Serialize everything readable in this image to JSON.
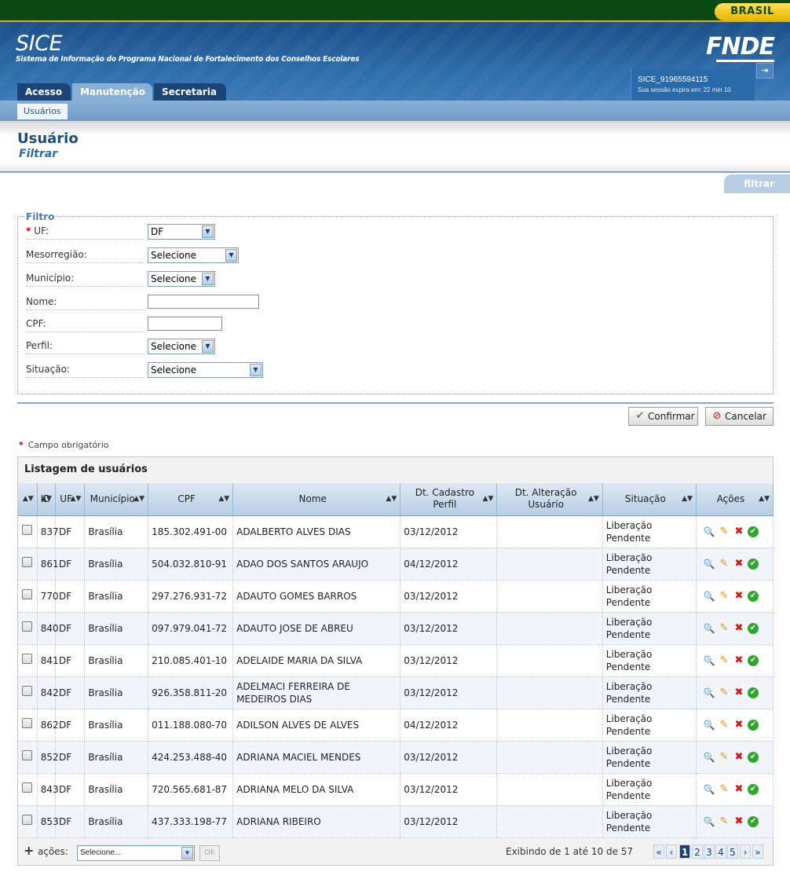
{
  "gov_badge": "BRASIL",
  "header": {
    "app_name": "SICE",
    "app_subtitle": "Sistema de Informação do Programa Nacional de Fortalecimento dos Conselhos Escolares",
    "logo": "FNDE",
    "session_user": "SICE_91965594115",
    "session_expire": "Sua sessão expira em: 22 min 10"
  },
  "tabs": [
    {
      "label": "Acesso"
    },
    {
      "label": "Manutenção",
      "active": true
    },
    {
      "label": "Secretaria"
    }
  ],
  "subnav": {
    "item": "Usuários"
  },
  "page": {
    "title": "Usuário",
    "subtitle": "Filtrar",
    "filter_tab": "filtrar"
  },
  "filter": {
    "legend": "Filtro",
    "required_mark": "*",
    "fields": {
      "uf": {
        "label": "UF:",
        "value": "DF"
      },
      "mesorregiao": {
        "label": "Mesorregião:",
        "value": "Selecione"
      },
      "municipio": {
        "label": "Município:",
        "value": "Selecione"
      },
      "nome": {
        "label": "Nome:",
        "value": ""
      },
      "cpf": {
        "label": "CPF:",
        "value": ""
      },
      "perfil": {
        "label": "Perfil:",
        "value": "Selecione"
      },
      "situacao": {
        "label": "Situação:",
        "value": "Selecione"
      }
    },
    "confirm_label": "Confirmar",
    "cancel_label": "Cancelar",
    "required_note": "Campo obrigatório"
  },
  "listing": {
    "title": "Listagem de usuários",
    "columns": [
      "",
      "ID",
      "UF",
      "Município",
      "CPF",
      "Nome",
      "Dt. Cadastro Perfil",
      "Dt. Alteração Usuário",
      "Situação",
      "Ações"
    ],
    "rows": [
      {
        "id": "837",
        "uf": "DF",
        "municipio": "Brasília",
        "cpf": "185.302.491-00",
        "nome": "ADALBERTO ALVES DIAS",
        "dt_cadastro": "03/12/2012",
        "dt_alteracao": "",
        "situacao": "Liberação Pendente"
      },
      {
        "id": "861",
        "uf": "DF",
        "municipio": "Brasília",
        "cpf": "504.032.810-91",
        "nome": "ADAO DOS SANTOS ARAUJO",
        "dt_cadastro": "04/12/2012",
        "dt_alteracao": "",
        "situacao": "Liberação Pendente"
      },
      {
        "id": "770",
        "uf": "DF",
        "municipio": "Brasília",
        "cpf": "297.276.931-72",
        "nome": "ADAUTO GOMES BARROS",
        "dt_cadastro": "03/12/2012",
        "dt_alteracao": "",
        "situacao": "Liberação Pendente"
      },
      {
        "id": "840",
        "uf": "DF",
        "municipio": "Brasília",
        "cpf": "097.979.041-72",
        "nome": "ADAUTO JOSE DE ABREU",
        "dt_cadastro": "03/12/2012",
        "dt_alteracao": "",
        "situacao": "Liberação Pendente"
      },
      {
        "id": "841",
        "uf": "DF",
        "municipio": "Brasília",
        "cpf": "210.085.401-10",
        "nome": "ADELAIDE MARIA DA SILVA",
        "dt_cadastro": "03/12/2012",
        "dt_alteracao": "",
        "situacao": "Liberação Pendente"
      },
      {
        "id": "842",
        "uf": "DF",
        "municipio": "Brasília",
        "cpf": "926.358.811-20",
        "nome": "ADELMACI FERREIRA DE MEDEIROS DIAS",
        "dt_cadastro": "03/12/2012",
        "dt_alteracao": "",
        "situacao": "Liberação Pendente"
      },
      {
        "id": "862",
        "uf": "DF",
        "municipio": "Brasília",
        "cpf": "011.188.080-70",
        "nome": "ADILSON ALVES DE ALVES",
        "dt_cadastro": "04/12/2012",
        "dt_alteracao": "",
        "situacao": "Liberação Pendente"
      },
      {
        "id": "852",
        "uf": "DF",
        "municipio": "Brasília",
        "cpf": "424.253.488-40",
        "nome": "ADRIANA MACIEL MENDES",
        "dt_cadastro": "03/12/2012",
        "dt_alteracao": "",
        "situacao": "Liberação Pendente"
      },
      {
        "id": "843",
        "uf": "DF",
        "municipio": "Brasília",
        "cpf": "720.565.681-87",
        "nome": "ADRIANA MELO DA SILVA",
        "dt_cadastro": "03/12/2012",
        "dt_alteracao": "",
        "situacao": "Liberação Pendente"
      },
      {
        "id": "853",
        "uf": "DF",
        "municipio": "Brasília",
        "cpf": "437.333.198-77",
        "nome": "ADRIANA RIBEIRO",
        "dt_cadastro": "03/12/2012",
        "dt_alteracao": "",
        "situacao": "Liberação Pendente"
      }
    ],
    "row_actions": [
      "view-icon",
      "edit-icon",
      "delete-icon",
      "approve-icon"
    ]
  },
  "footer": {
    "plus": "+",
    "acoes_label": "ações:",
    "select_value": "Selecione...",
    "ok_label": "Ok",
    "pager_info": "Exibindo de 1 até 10 de 57",
    "pages": [
      "1",
      "2",
      "3",
      "4",
      "5"
    ],
    "current_page": "1",
    "first": "«",
    "prev": "‹",
    "next": "›",
    "last": "»"
  }
}
